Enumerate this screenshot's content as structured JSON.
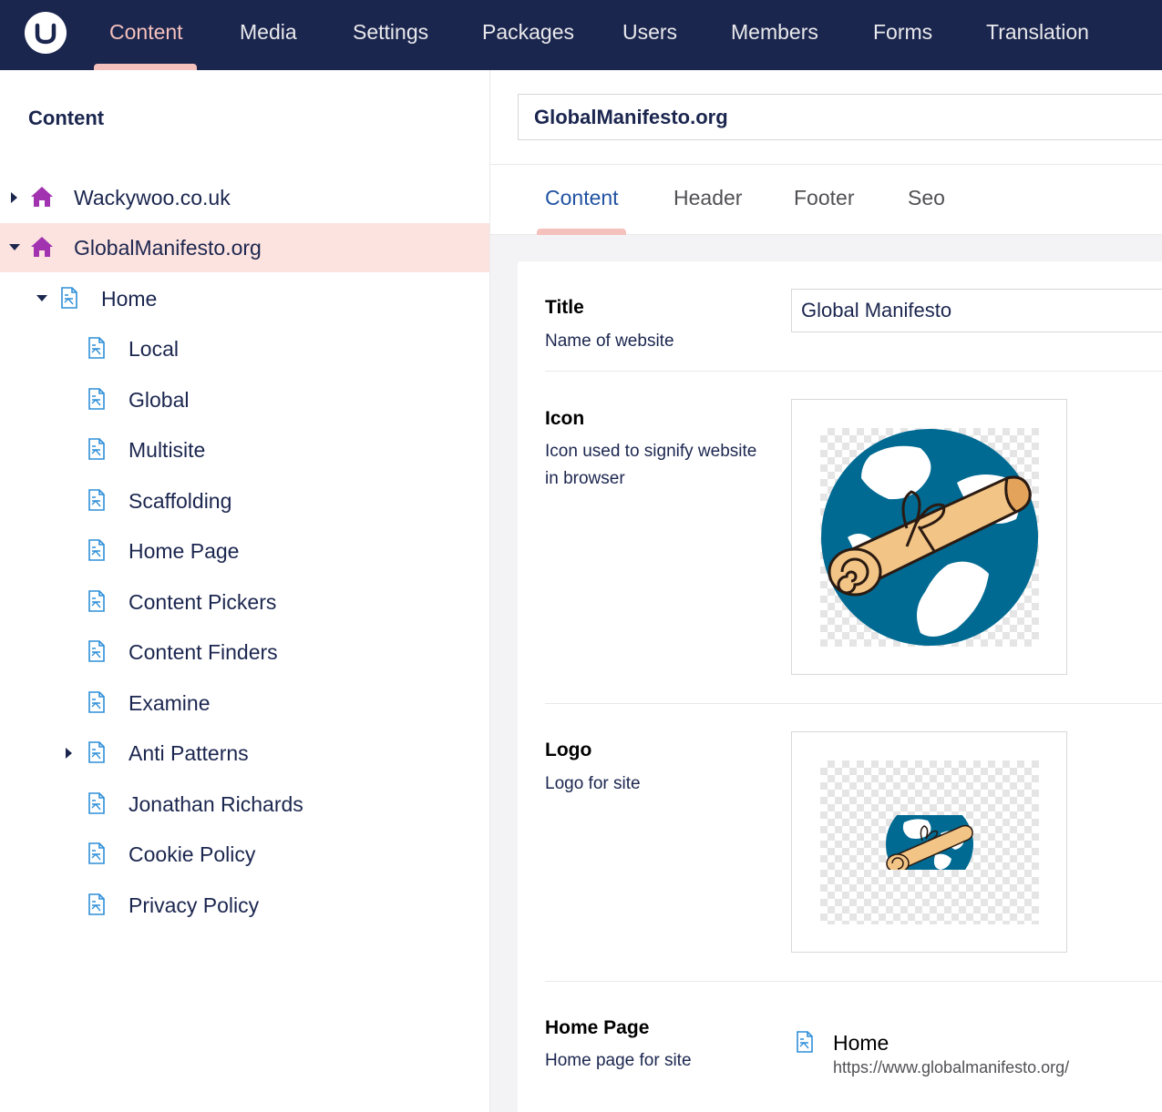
{
  "nav": {
    "items": [
      "Content",
      "Media",
      "Settings",
      "Packages",
      "Users",
      "Members",
      "Forms",
      "Translation"
    ],
    "active_color": "#f5c1bc",
    "background": "#1b264f"
  },
  "tree": {
    "heading": "Content",
    "roots": [
      {
        "label": "Wackywoo.co.uk",
        "icon": "house-icon",
        "expanded": false
      },
      {
        "label": "GlobalManifesto.org",
        "icon": "house-icon",
        "expanded": true,
        "selected": true
      }
    ],
    "home": {
      "label": "Home",
      "icon": "document-icon",
      "expanded": true
    },
    "children": [
      "Local",
      "Global",
      "Multisite",
      "Scaffolding",
      "Home Page",
      "Content Pickers",
      "Content Finders",
      "Examine",
      "Anti Patterns",
      "Jonathan Richards",
      "Cookie Policy",
      "Privacy Policy"
    ]
  },
  "editor": {
    "node_name": "GlobalManifesto.org",
    "tabs": [
      "Content",
      "Header",
      "Footer",
      "Seo"
    ],
    "properties": {
      "title": {
        "label": "Title",
        "description": "Name of website",
        "value": "Global Manifesto"
      },
      "icon": {
        "label": "Icon",
        "description": "Icon used to signify website in browser"
      },
      "logo": {
        "label": "Logo",
        "description": "Logo for site"
      },
      "home_page": {
        "label": "Home Page",
        "description": "Home page for site",
        "picked_name": "Home",
        "picked_url": "https://www.globalmanifesto.org/"
      }
    }
  }
}
